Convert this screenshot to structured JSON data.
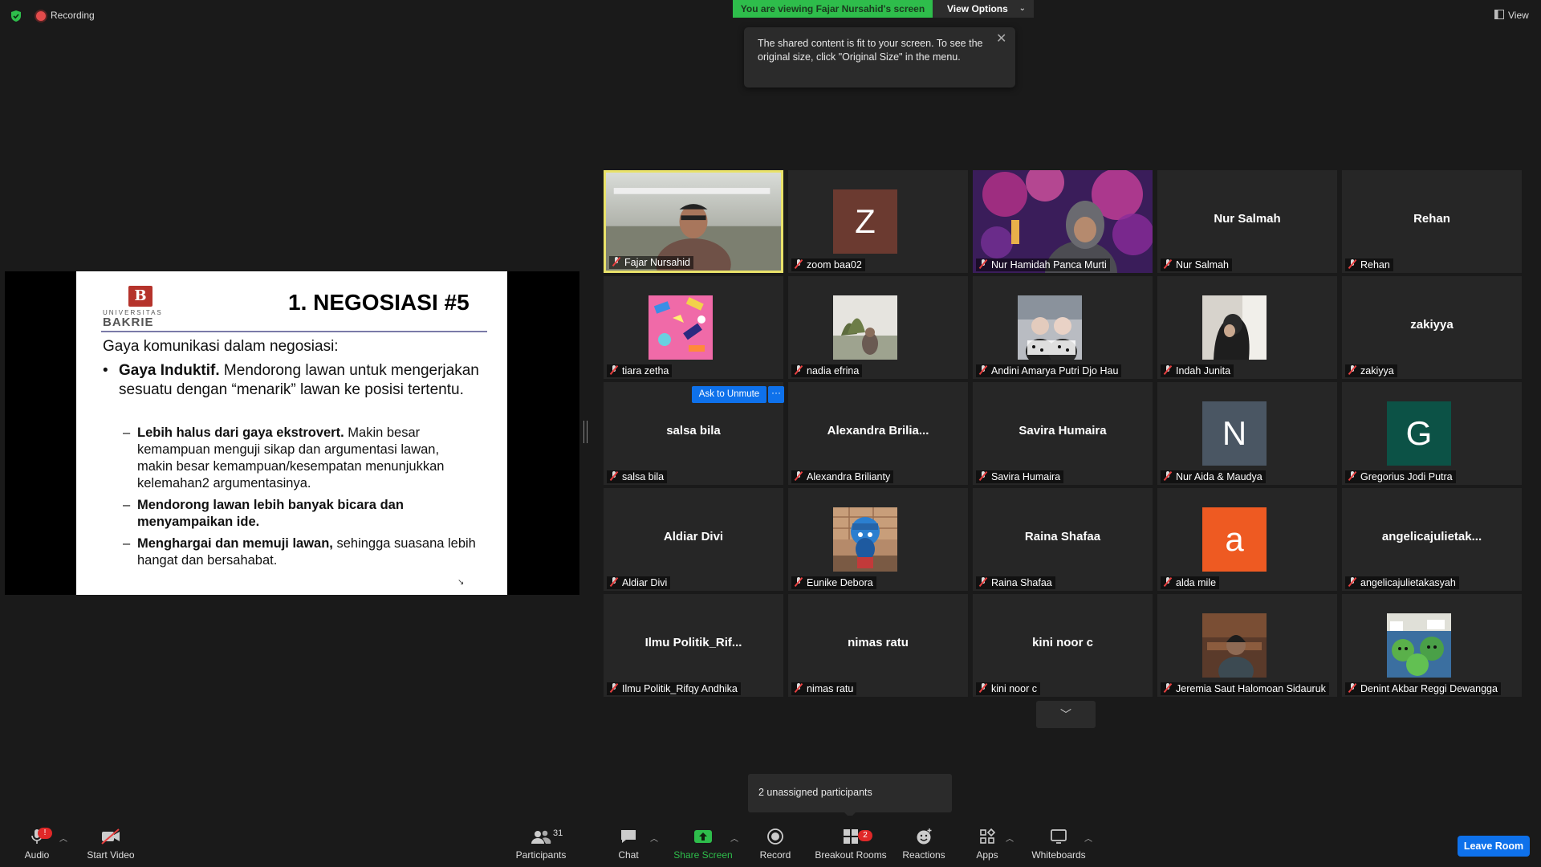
{
  "top": {
    "recording_label": "Recording",
    "viewing_banner": "You are viewing Fajar Nursahid's screen",
    "view_options_label": "View Options",
    "view_label": "View"
  },
  "tooltip": {
    "text": "The shared content is fit to your screen. To see the\noriginal size, click \"Original Size\" in the menu."
  },
  "slide": {
    "logo_letter": "B",
    "logo_university": "UNIVERSITAS",
    "logo_name": "BAKRIE",
    "title": "1. NEGOSIASI #5",
    "intro": "Gaya komunikasi dalam negosiasi:",
    "bullet_bold": "Gaya Induktif.",
    "bullet_text": " Mendorong lawan untuk mengerjakan sesuatu dengan “menarik” lawan ke posisi tertentu.",
    "sub1_bold": "Lebih halus dari gaya ekstrovert.",
    "sub1_text": " Makin besar kemampuan menguji sikap dan argumentasi lawan, makin besar kemampuan/kesempatan menunjukkan kelemahan2 argumentasinya.",
    "sub2_bold": "Mendorong lawan lebih banyak bicara dan menyampaikan ide.",
    "sub3_bold": "Menghargai dan memuji lawan,",
    "sub3_text": " sehingga suasana lebih hangat dan bersahabat."
  },
  "gallery": {
    "ask_unmute_label": "Ask to Unmute",
    "more_label": "···",
    "tiles": [
      {
        "caption": "Fajar Nursahid",
        "big": "",
        "kind": "video-fajar"
      },
      {
        "caption": "zoom baa02",
        "big": "",
        "kind": "letter",
        "letter": "Z",
        "color": "#6b3a30"
      },
      {
        "caption": "Nur Hamidah Panca Murti",
        "big": "",
        "kind": "video-hamidah"
      },
      {
        "caption": "Nur Salmah",
        "big": "Nur Salmah",
        "kind": "name"
      },
      {
        "caption": "Rehan",
        "big": "Rehan",
        "kind": "name"
      },
      {
        "caption": "tiara zetha",
        "big": "",
        "kind": "avatar-pattern"
      },
      {
        "caption": "nadia efrina",
        "big": "",
        "kind": "avatar-photo"
      },
      {
        "caption": "Andini Amarya Putri Djo Hau",
        "big": "",
        "kind": "avatar-photo2"
      },
      {
        "caption": "Indah Junita",
        "big": "",
        "kind": "avatar-photo3"
      },
      {
        "caption": "zakiyya",
        "big": "zakiyya",
        "kind": "name"
      },
      {
        "caption": "salsa bila",
        "big": "salsa bila",
        "kind": "name"
      },
      {
        "caption": "Alexandra Brilianty",
        "big": "Alexandra  Brilia...",
        "kind": "name"
      },
      {
        "caption": "Savira Humaira",
        "big": "Savira Humaira",
        "kind": "name"
      },
      {
        "caption": "Nur Aida & Maudya",
        "big": "",
        "kind": "letter",
        "letter": "N",
        "color": "#4a5663"
      },
      {
        "caption": "Gregorius Jodi Putra",
        "big": "",
        "kind": "letter",
        "letter": "G",
        "color": "#0c5246"
      },
      {
        "caption": "Aldiar Divi",
        "big": "Aldiar Divi",
        "kind": "name"
      },
      {
        "caption": "Eunike Debora",
        "big": "",
        "kind": "avatar-photo4"
      },
      {
        "caption": "Raina Shafaa",
        "big": "Raina Shafaa",
        "kind": "name"
      },
      {
        "caption": "alda mile",
        "big": "",
        "kind": "letter",
        "letter": "a",
        "color": "#ee5a22"
      },
      {
        "caption": "angelicajulietakasyah",
        "big": "angelicajulietak...",
        "kind": "name"
      },
      {
        "caption": "Ilmu Politik_Rifqy Andhika",
        "big": "Ilmu  Politik_Rif...",
        "kind": "name"
      },
      {
        "caption": "nimas ratu",
        "big": "nimas ratu",
        "kind": "name"
      },
      {
        "caption": "kini noor c",
        "big": "kini noor c",
        "kind": "name"
      },
      {
        "caption": "Jeremia Saut Halomoan Sidauruk",
        "big": "",
        "kind": "avatar-photo5"
      },
      {
        "caption": "Denint Akbar Reggi Dewangga",
        "big": "",
        "kind": "avatar-photo6"
      }
    ]
  },
  "unassigned": "2 unassigned participants",
  "toolbar": {
    "audio": "Audio",
    "audio_badge": "!",
    "start_video": "Start Video",
    "participants": "Participants",
    "participants_count": "31",
    "chat": "Chat",
    "share_screen": "Share Screen",
    "record": "Record",
    "breakout_rooms": "Breakout Rooms",
    "breakout_badge": "2",
    "reactions": "Reactions",
    "apps": "Apps",
    "whiteboards": "Whiteboards",
    "leave_room": "Leave Room"
  },
  "colors": {
    "background": "#1a1a1a",
    "tile": "#262626",
    "accent_blue": "#0e71eb",
    "share_green": "#2ebd4b",
    "active_speaker": "#e9e26a",
    "alert_red": "#e02828"
  }
}
